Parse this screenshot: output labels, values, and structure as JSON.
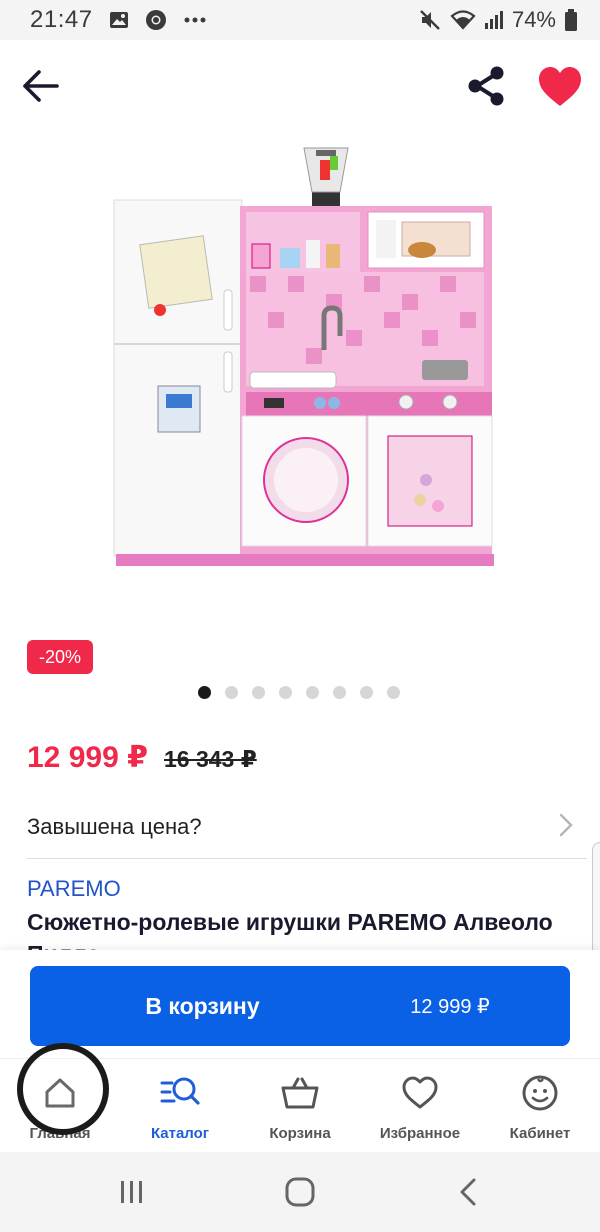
{
  "status_bar": {
    "time": "21:47",
    "battery": "74%",
    "notification_icons": [
      "image-icon",
      "chrome-icon",
      "more-icon"
    ],
    "system_icons": [
      "mute-icon",
      "wifi-icon",
      "signal-icon",
      "battery-icon"
    ]
  },
  "product": {
    "discount": "-20%",
    "price_current": "12 999 ₽",
    "price_old": "16 343 ₽",
    "overpriced_link": "Завышена цена?",
    "brand": "PAREMO",
    "title": "Сюжетно-ролевые игрушки PAREMO Алвеоло Пилла",
    "image_count": 8,
    "active_image": 1
  },
  "cart": {
    "button_label": "В корзину",
    "button_price": "12 999 ₽"
  },
  "bottom_nav": {
    "items": [
      {
        "label": "Главная",
        "icon": "home-icon"
      },
      {
        "label": "Каталог",
        "icon": "catalog-search-icon"
      },
      {
        "label": "Корзина",
        "icon": "basket-icon"
      },
      {
        "label": "Избранное",
        "icon": "heart-outline-icon"
      },
      {
        "label": "Кабинет",
        "icon": "profile-icon"
      }
    ],
    "active_index": 1
  },
  "colors": {
    "accent_blue": "#0a61e6",
    "price_red": "#f0284a",
    "brand_blue": "#2354c7",
    "favorite_red": "#f0284a"
  }
}
